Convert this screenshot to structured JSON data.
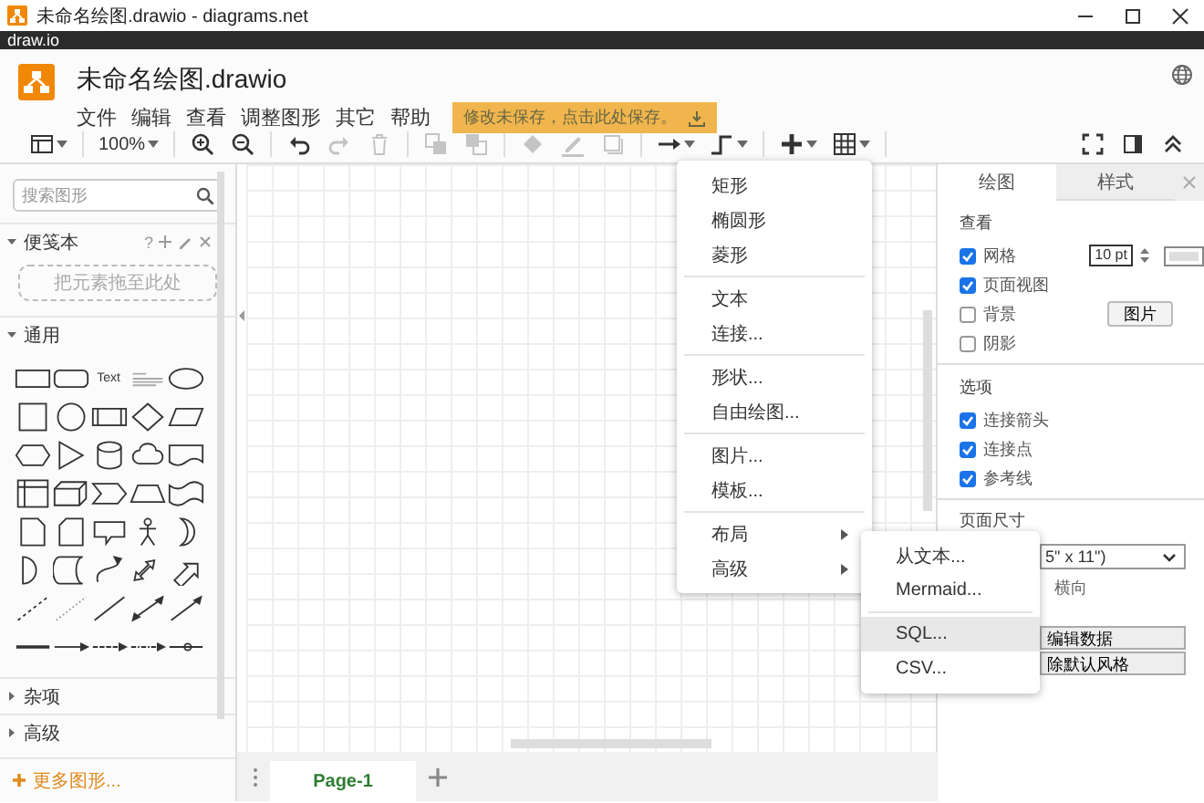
{
  "window": {
    "title": "未命名绘图.drawio - diagrams.net"
  },
  "app_bar": {
    "label": "draw.io"
  },
  "header": {
    "file_name": "未命名绘图.drawio",
    "menu": [
      "文件",
      "编辑",
      "查看",
      "调整图形",
      "其它",
      "帮助"
    ],
    "save_notice": "修改未保存，点击此处保存。"
  },
  "toolbar": {
    "groups": [
      [
        {
          "kind": "panels",
          "disabled": false
        }
      ],
      [
        {
          "kind": "zoom",
          "label": "100%",
          "disabled": false
        }
      ],
      [
        {
          "kind": "zoom-in",
          "disabled": false
        },
        {
          "kind": "zoom-out",
          "disabled": false
        }
      ],
      [
        {
          "kind": "undo",
          "disabled": false
        },
        {
          "kind": "redo",
          "disabled": true
        },
        {
          "kind": "delete",
          "disabled": true
        }
      ],
      [
        {
          "kind": "to-front",
          "disabled": true
        },
        {
          "kind": "to-back",
          "disabled": true
        }
      ],
      [
        {
          "kind": "fill",
          "disabled": true
        },
        {
          "kind": "line-color",
          "disabled": true
        },
        {
          "kind": "shadow",
          "disabled": true
        }
      ],
      [
        {
          "kind": "connection",
          "disabled": false
        },
        {
          "kind": "waypoints",
          "disabled": false
        }
      ],
      [
        {
          "kind": "insert",
          "disabled": false
        },
        {
          "kind": "table",
          "disabled": false
        }
      ]
    ],
    "right": [
      {
        "kind": "fullscreen",
        "disabled": false
      },
      {
        "kind": "format-panel",
        "disabled": false
      },
      {
        "kind": "collapse",
        "disabled": false
      }
    ]
  },
  "sidebar": {
    "search": {
      "placeholder": "搜索图形"
    },
    "scratchpad": {
      "title": "便笺本",
      "expanded": true,
      "help": "?",
      "drop_zone": "把元素拖至此处"
    },
    "sections": [
      {
        "title": "通用",
        "expanded": true
      },
      {
        "title": "杂项",
        "expanded": false
      },
      {
        "title": "高级",
        "expanded": false
      }
    ],
    "text_sample": "Text",
    "more_shapes": "更多图形..."
  },
  "insert_menu": {
    "groups": [
      [
        {
          "label": "矩形",
          "submenu": false
        },
        {
          "label": "椭圆形",
          "submenu": false
        },
        {
          "label": "菱形",
          "submenu": false
        }
      ],
      [
        {
          "label": "文本",
          "submenu": false
        },
        {
          "label": "连接...",
          "submenu": false
        }
      ],
      [
        {
          "label": "形状...",
          "submenu": false
        },
        {
          "label": "自由绘图...",
          "submenu": false
        }
      ],
      [
        {
          "label": "图片...",
          "submenu": false
        },
        {
          "label": "模板...",
          "submenu": false
        }
      ],
      [
        {
          "label": "布局",
          "submenu": true
        },
        {
          "label": "高级",
          "submenu": true
        }
      ]
    ]
  },
  "advanced_submenu": {
    "groups": [
      [
        {
          "label": "从文本...",
          "selected": false
        },
        {
          "label": "Mermaid...",
          "selected": false
        }
      ],
      [
        {
          "label": "SQL...",
          "selected": true
        },
        {
          "label": "CSV...",
          "selected": false
        }
      ]
    ]
  },
  "format_panel": {
    "tabs": [
      {
        "label": "绘图",
        "selected": true
      },
      {
        "label": "样式",
        "selected": false
      }
    ],
    "sections": [
      {
        "title": "查看",
        "options": [
          {
            "label": "网格",
            "checked": true,
            "size_field": "10 pt"
          },
          {
            "label": "页面视图",
            "checked": true
          },
          {
            "label": "背景",
            "checked": false,
            "button": "图片"
          },
          {
            "label": "阴影",
            "checked": false
          }
        ]
      },
      {
        "title": "选项",
        "options": [
          {
            "label": "连接箭头",
            "checked": true
          },
          {
            "label": "连接点",
            "checked": true
          },
          {
            "label": "参考线",
            "checked": true
          }
        ]
      }
    ],
    "page_size": {
      "title": "页面尺寸",
      "paper": "5\" x 11\")",
      "orientation": "横向",
      "buttons": [
        "编辑数据",
        "除默认风格"
      ]
    }
  },
  "pages": [
    {
      "label": "Page-1",
      "selected": true
    }
  ]
}
